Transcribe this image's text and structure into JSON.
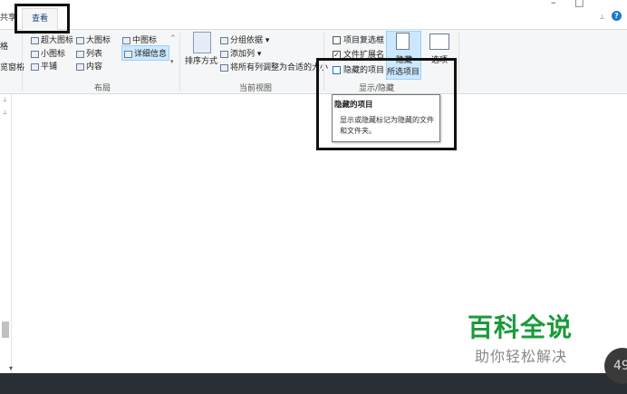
{
  "window": {
    "minimize_glyph": "–",
    "maximize_glyph": "□",
    "pin_glyph": "⟂",
    "help_glyph": "?"
  },
  "tabs": {
    "share": "共享",
    "view": "查看"
  },
  "left_pane": {
    "item1": "格",
    "item2": "览窗格"
  },
  "layout_group": {
    "items": [
      "超大图标",
      "大图标",
      "中图标",
      "小图标",
      "列表",
      "详细信息",
      "平铺",
      "内容"
    ],
    "label": "布局",
    "scroll_up": "^",
    "scroll_down": "▾"
  },
  "current_view_group": {
    "sort_label": "排序方式",
    "group_by": "分组依据 ▾",
    "add_column": "添加列 ▾",
    "fit_columns": "将所有列调整为合适的大小",
    "label": "当前视图"
  },
  "show_hide_group": {
    "item_checkbox": "项目复选框",
    "file_ext": "文件扩展名",
    "hidden_items": "隐藏的项目",
    "hide_selected": "隐藏",
    "selected_items": "所选项目",
    "options": "选项",
    "label": "显示/隐藏",
    "checks": {
      "item_checkbox": false,
      "file_ext": true,
      "hidden_items": false
    }
  },
  "tooltip": {
    "title": "隐藏的项目",
    "body": "显示或隐藏标记为隐藏的文件和文件夹。"
  },
  "watermark": {
    "title": "百科全说",
    "subtitle": "助你轻松解决"
  },
  "badge": "49",
  "colors": {
    "accent": "#1979ca",
    "watermark_green": "#1a9a3a",
    "highlight_border": "#111111"
  }
}
